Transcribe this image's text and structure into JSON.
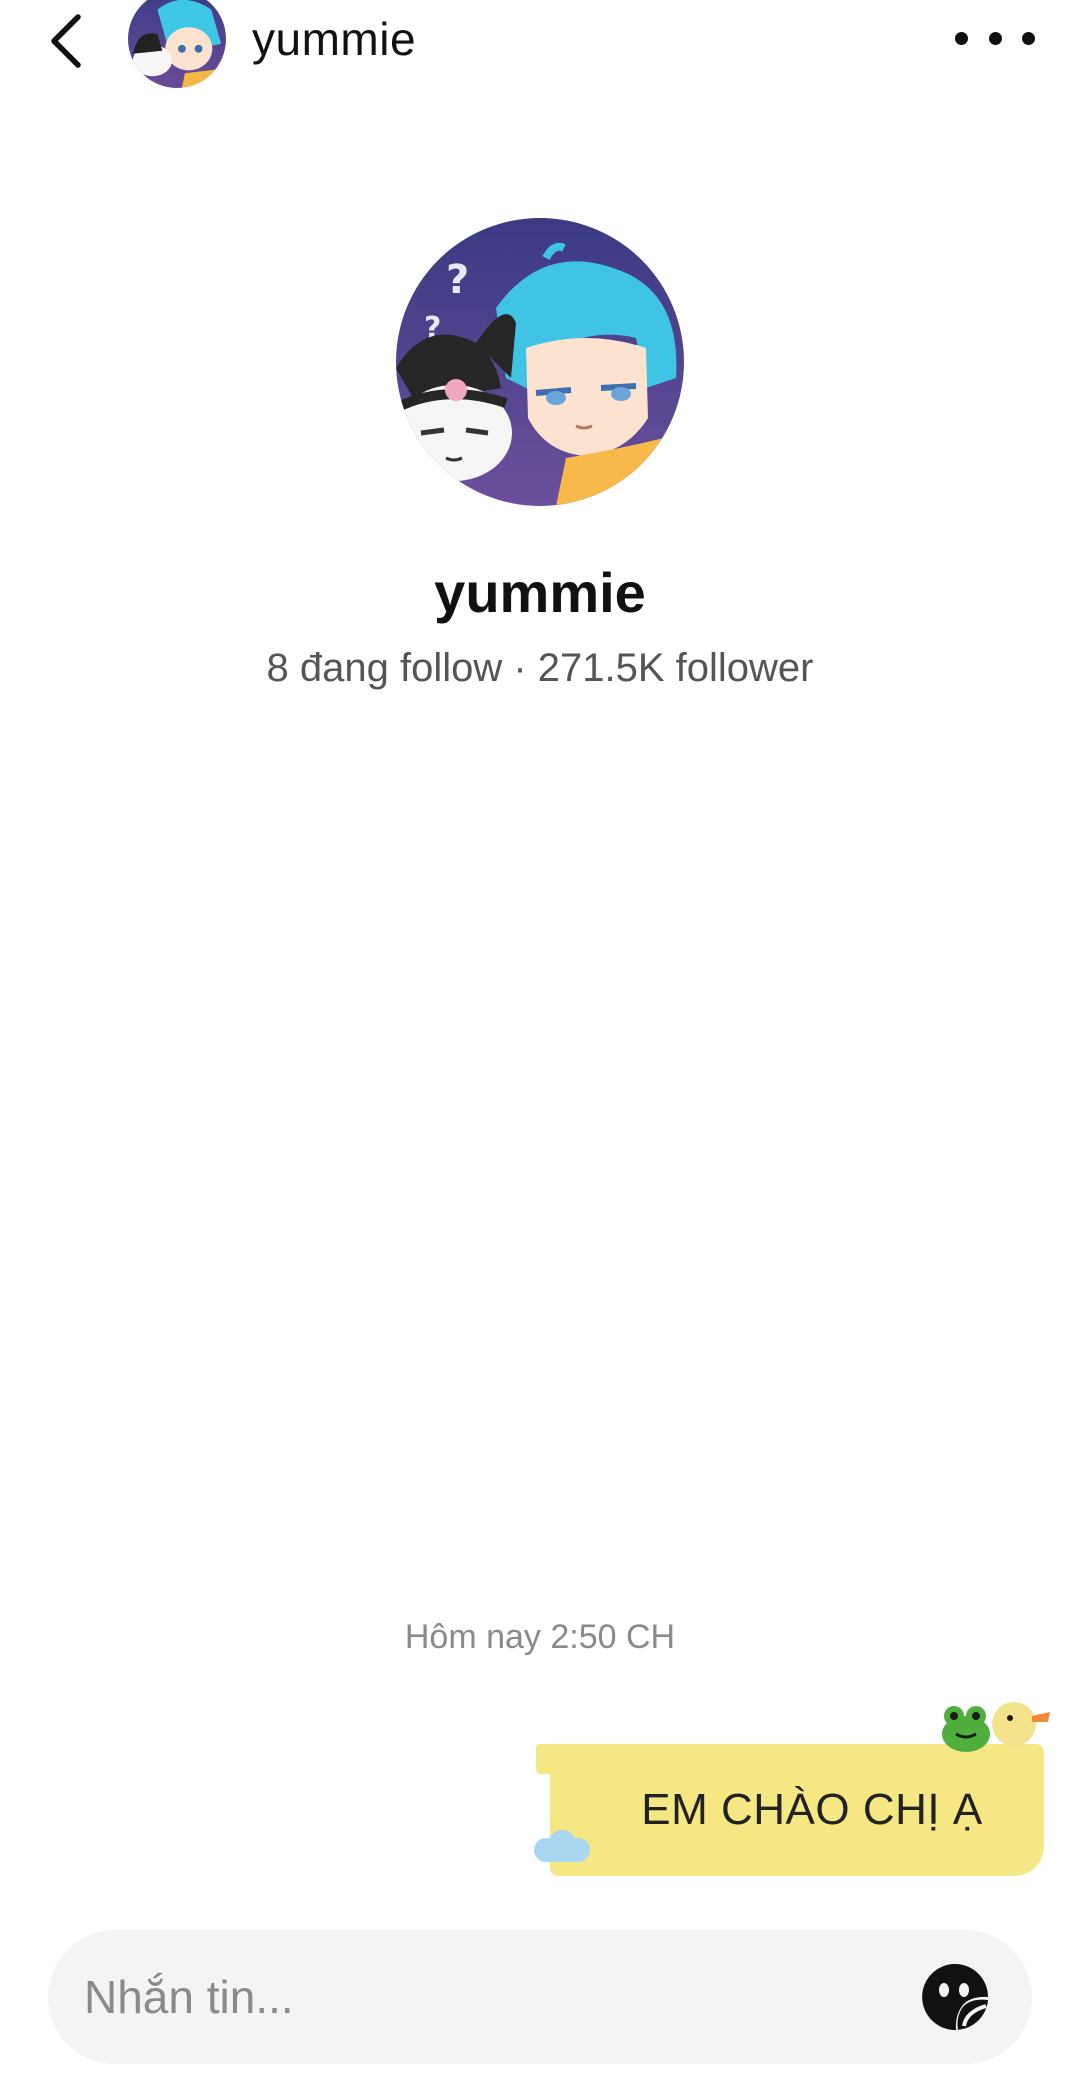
{
  "header": {
    "back_icon": "chevron-left-icon",
    "username": "yummie",
    "more_icon": "more-horizontal-icon"
  },
  "profile": {
    "name": "yummie",
    "stats": "8 đang follow · 271.5K follower"
  },
  "conversation": {
    "timestamp": "Hôm nay 2:50 CH",
    "messages": [
      {
        "sender": "me",
        "text": "EM CHÀO CHỊ Ạ"
      }
    ]
  },
  "composer": {
    "placeholder": "Nhắn tin...",
    "value": "",
    "sticker_icon": "sticker-icon"
  },
  "colors": {
    "bubble": "#f5e884",
    "input_bg": "#f4f4f4",
    "secondary_text": "#555555",
    "timestamp_text": "#8a8a8a"
  }
}
